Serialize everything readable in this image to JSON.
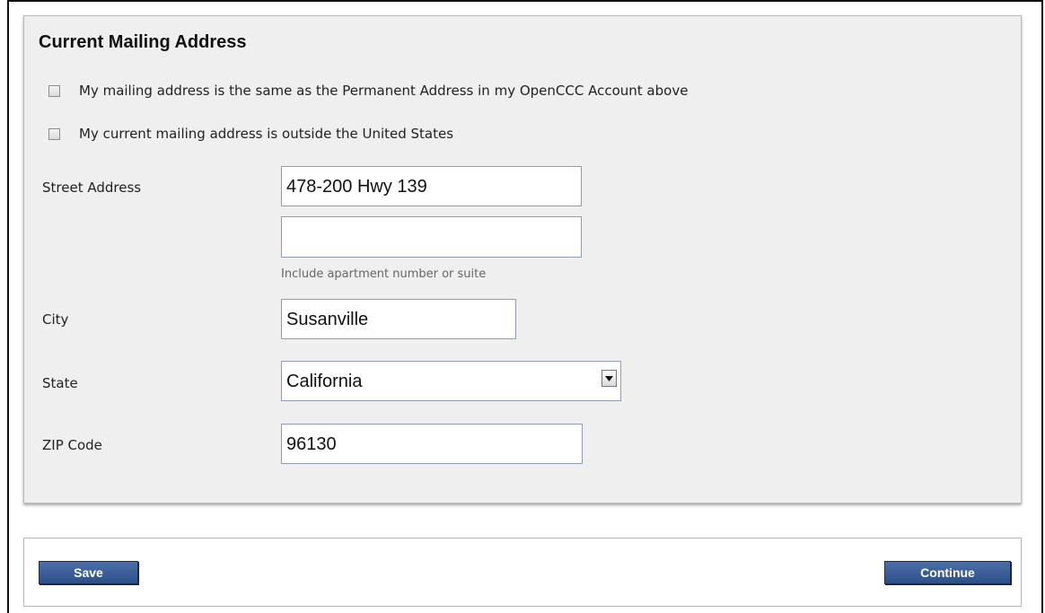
{
  "section": {
    "title": "Current Mailing Address",
    "checkbox_same_as_permanent": "My mailing address is the same as the Permanent Address in my OpenCCC Account above",
    "checkbox_outside_us": "My current mailing address is outside the United States"
  },
  "form": {
    "street_label": "Street Address",
    "street_line1_value": "478-200 Hwy 139",
    "street_line2_value": "",
    "street_hint": "Include apartment number or suite",
    "city_label": "City",
    "city_value": "Susanville",
    "state_label": "State",
    "state_value": "California",
    "zip_label": "ZIP Code",
    "zip_value": "96130"
  },
  "footer": {
    "save_label": "Save",
    "continue_label": "Continue"
  },
  "colors": {
    "panel_bg": "#efefef",
    "button_bg": "#2c4f8a",
    "input_border": "#8e9cb6"
  },
  "icons": {
    "select_arrow": "chevron-down-icon"
  }
}
